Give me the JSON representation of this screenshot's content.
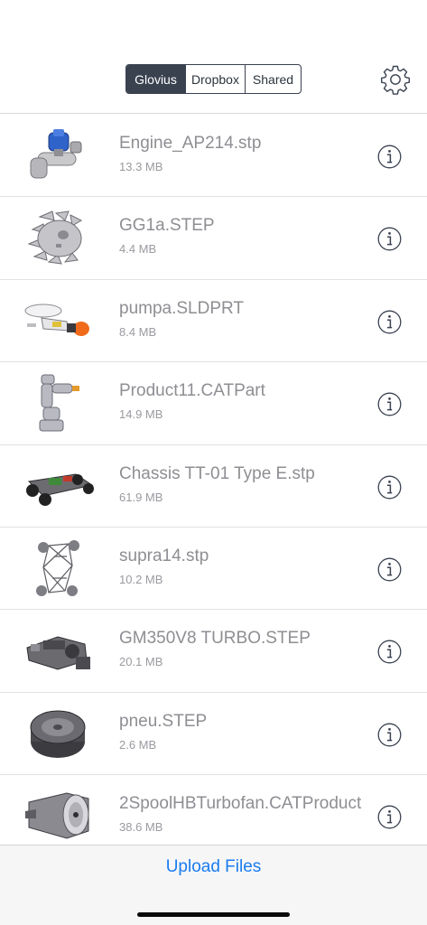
{
  "segments": [
    {
      "label": "Glovius",
      "active": true
    },
    {
      "label": "Dropbox",
      "active": false
    },
    {
      "label": "Shared",
      "active": false
    }
  ],
  "settings_icon": "gear-icon",
  "info_icon": "info-circle-icon",
  "files": [
    {
      "name": "Engine_AP214.stp",
      "size": "13.3 MB",
      "thumb": "engine-thumbnail"
    },
    {
      "name": "GG1a.STEP",
      "size": "4.4 MB",
      "thumb": "gear-part-thumbnail"
    },
    {
      "name": "pumpa.SLDPRT",
      "size": "8.4 MB",
      "thumb": "pump-thumbnail"
    },
    {
      "name": "Product11.CATPart",
      "size": "14.9 MB",
      "thumb": "robot-arm-thumbnail"
    },
    {
      "name": "Chassis TT-01 Type E.stp",
      "size": "61.9 MB",
      "thumb": "rc-chassis-thumbnail"
    },
    {
      "name": "supra14.stp",
      "size": "10.2 MB",
      "thumb": "space-frame-thumbnail"
    },
    {
      "name": "GM350V8 TURBO.STEP",
      "size": "20.1 MB",
      "thumb": "v8-engine-thumbnail"
    },
    {
      "name": "pneu.STEP",
      "size": "2.6 MB",
      "thumb": "tire-thumbnail"
    },
    {
      "name": "2SpoolHBTurbofan.CATProduct",
      "size": "38.6 MB",
      "thumb": "turbofan-thumbnail"
    }
  ],
  "bottom": {
    "upload_label": "Upload Files"
  },
  "colors": {
    "accent": "#1a7cf0",
    "segment_dark": "#3a4250",
    "text_gray": "#8e8e93"
  }
}
